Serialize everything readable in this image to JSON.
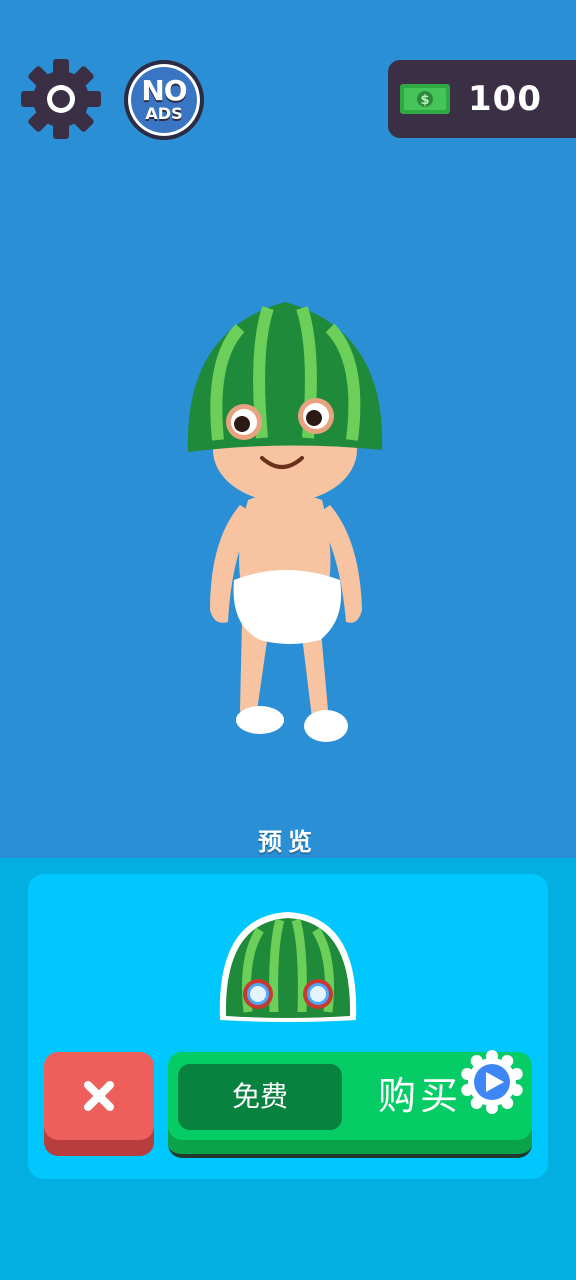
{
  "hud": {
    "money_value": "100",
    "no_ads": {
      "top": "NO",
      "bottom": "ADS"
    }
  },
  "preview": {
    "label": "预览"
  },
  "item_panel": {
    "free_label": "免费",
    "buy_label": "购买"
  },
  "colors": {
    "sky_blue": "#2b8fd6",
    "panel_cyan": "#00c8ff",
    "close_red": "#ee5e5b",
    "buy_green": "#05cc65",
    "money_panel": "#3b2f45"
  },
  "icons": [
    "gear-icon",
    "no-ads-icon",
    "cash-icon",
    "close-icon",
    "video-ad-icon"
  ]
}
